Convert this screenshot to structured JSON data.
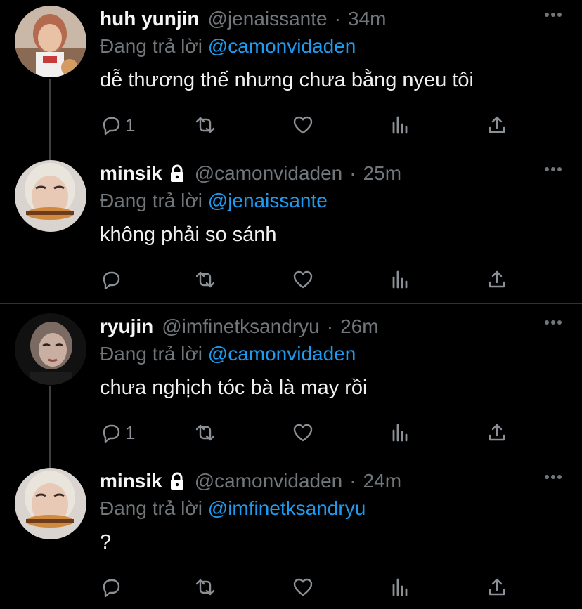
{
  "reply_prefix": "Đang trả lời",
  "colors": {
    "accent": "#1d9bf0",
    "muted": "#71767b",
    "background": "#000000"
  },
  "tweets": [
    {
      "name": "huh yunjin",
      "handle": "@jenaissante",
      "time": "34m",
      "reply_to": "@camonvidaden",
      "text": "dễ thương thế nhưng chưa bằng nyeu tôi",
      "reply_count": "1",
      "locked": false
    },
    {
      "name": "minsik",
      "handle": "@camonvidaden",
      "time": "25m",
      "reply_to": "@jenaissante",
      "text": "không phải so sánh",
      "reply_count": "",
      "locked": true
    },
    {
      "name": "ryujin",
      "handle": "@imfinetksandryu",
      "time": "26m",
      "reply_to": "@camonvidaden",
      "text": "chưa nghịch tóc bà là may rồi",
      "reply_count": "1",
      "locked": false
    },
    {
      "name": "minsik",
      "handle": "@camonvidaden",
      "time": "24m",
      "reply_to": "@imfinetksandryu",
      "text": "?",
      "reply_count": "",
      "locked": true
    }
  ],
  "icons": {
    "reply": "reply-icon",
    "retweet": "retweet-icon",
    "like": "heart-icon",
    "views": "analytics-icon",
    "share": "share-icon",
    "more": "more-icon",
    "lock": "lock-icon"
  }
}
